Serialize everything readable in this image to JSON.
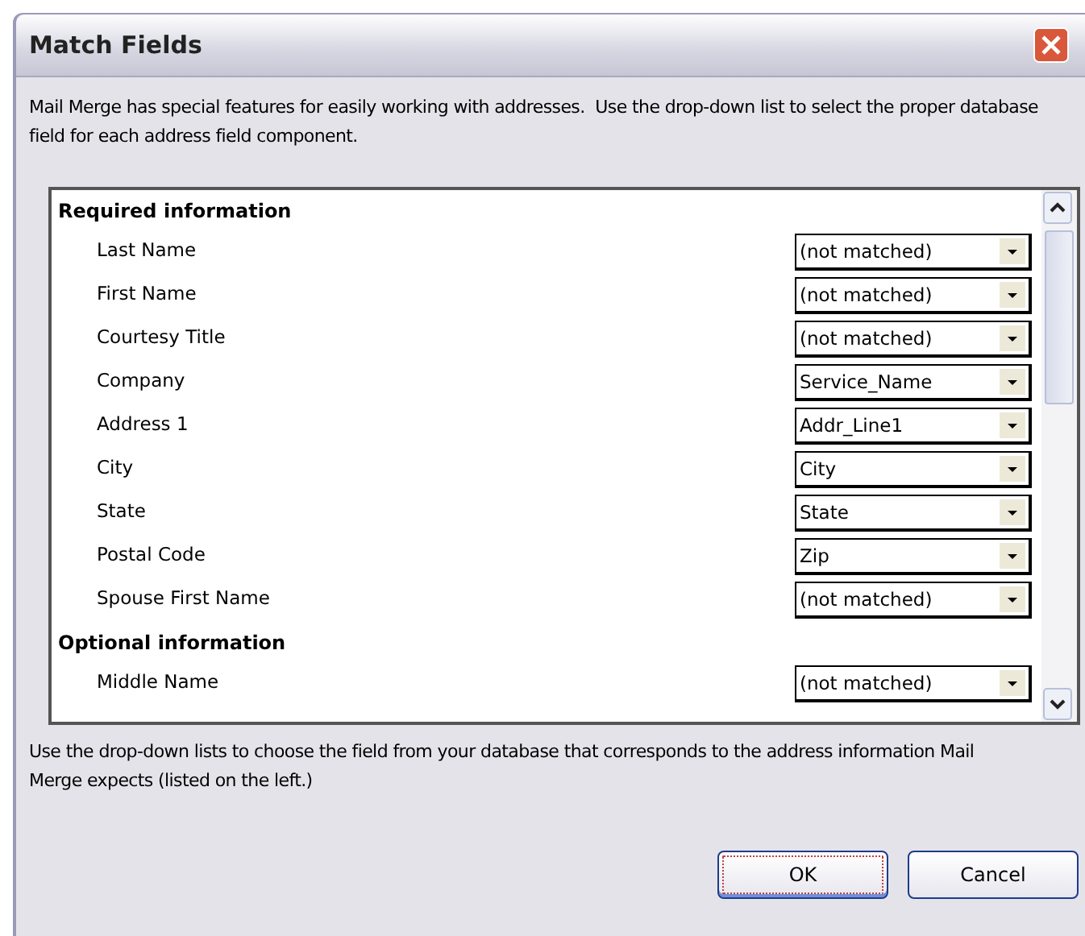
{
  "window": {
    "title": "Match Fields"
  },
  "intro": "Mail Merge has special features for easily working with addresses.  Use the drop-down list to select the proper database field for each address field component.",
  "sections": [
    {
      "title": "Required information",
      "fields": [
        {
          "label": "Last Name",
          "value": "(not matched)"
        },
        {
          "label": "First Name",
          "value": "(not matched)"
        },
        {
          "label": "Courtesy Title",
          "value": "(not matched)"
        },
        {
          "label": "Company",
          "value": "Service_Name"
        },
        {
          "label": "Address 1",
          "value": "Addr_Line1"
        },
        {
          "label": "City",
          "value": "City"
        },
        {
          "label": "State",
          "value": "State"
        },
        {
          "label": "Postal Code",
          "value": "Zip"
        },
        {
          "label": "Spouse First Name",
          "value": "(not matched)"
        }
      ]
    },
    {
      "title": "Optional information",
      "fields": [
        {
          "label": "Middle Name",
          "value": "(not matched)"
        }
      ]
    }
  ],
  "hint": "Use the drop-down lists to choose the field from your database that corresponds to the address information Mail Merge expects (listed on the left.)",
  "buttons": [
    {
      "label": "OK",
      "default": true
    },
    {
      "label": "Cancel",
      "default": false
    }
  ]
}
